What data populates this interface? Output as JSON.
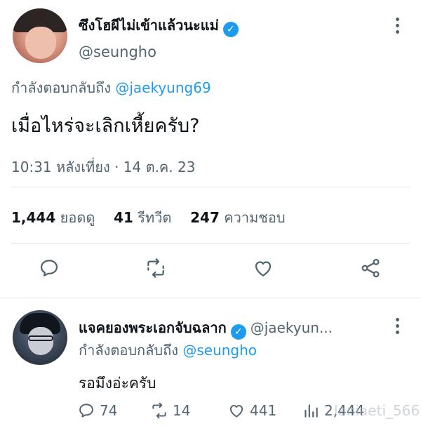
{
  "main_tweet": {
    "display_name": "ซึงโฮผีไม่เข้าแล้วนะแม่",
    "handle": "@seungho",
    "replying_to_prefix": "กำลังตอบกลับถึง",
    "replying_to_handle": "@jaekyung69",
    "text": "เมื่อไหร่จะเลิกเหี้ยครับ?",
    "timestamp": "10:31 หลังเที่ยง · 14 ต.ค. 23",
    "stats": {
      "views_count": "1,444",
      "views_label": "ยอดดู",
      "retweets_count": "41",
      "retweets_label": "รีทวีต",
      "likes_count": "247",
      "likes_label": "ความชอบ"
    },
    "icons": [
      "reply-icon",
      "retweet-icon",
      "like-icon",
      "share-icon"
    ]
  },
  "reply_tweet": {
    "display_name": "แจคยองพระเอกจับฉลาก",
    "handle": "@jaekyun...",
    "replying_to_prefix": "กำลังตอบกลับถึง",
    "replying_to_handle": "@seungho",
    "text": "รอมึงอ่ะครับ",
    "actions": {
      "replies": "74",
      "retweets": "14",
      "likes": "441",
      "views": "2,444"
    }
  },
  "watermark": "laniaeti_566",
  "colors": {
    "text_primary": "#0f1419",
    "text_secondary": "#536471",
    "accent": "#1d9bf0",
    "divider": "#dfe4e8"
  }
}
